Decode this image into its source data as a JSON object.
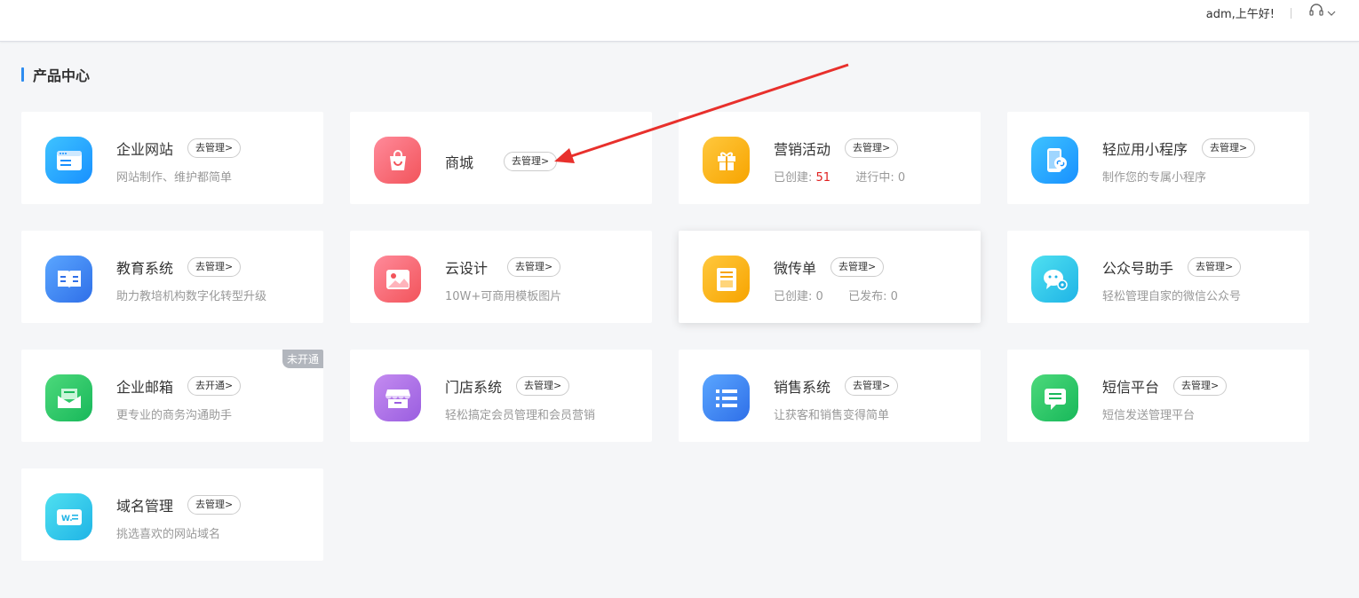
{
  "header": {
    "greeting": "adm,上午好!"
  },
  "section": {
    "title": "产品中心"
  },
  "cards": {
    "website": {
      "name": "企业网站",
      "action": "去管理>",
      "desc": "网站制作、维护都简单"
    },
    "mall": {
      "name": "商城",
      "action": "去管理>"
    },
    "marketing": {
      "name": "营销活动",
      "action": "去管理>",
      "created_label": "已创建:",
      "created_value": "51",
      "running_label": "进行中:",
      "running_value": "0"
    },
    "miniapp": {
      "name": "轻应用小程序",
      "action": "去管理>",
      "desc": "制作您的专属小程序"
    },
    "education": {
      "name": "教育系统",
      "action": "去管理>",
      "desc": "助力教培机构数字化转型升级"
    },
    "clouddesign": {
      "name": "云设计",
      "action": "去管理>",
      "desc": "10W+可商用模板图片"
    },
    "flyer": {
      "name": "微传单",
      "action": "去管理>",
      "created_label": "已创建:",
      "created_value": "0",
      "published_label": "已发布:",
      "published_value": "0"
    },
    "wechat": {
      "name": "公众号助手",
      "action": "去管理>",
      "desc": "轻松管理自家的微信公众号"
    },
    "email": {
      "name": "企业邮箱",
      "action": "去开通>",
      "desc": "更专业的商务沟通助手",
      "badge": "未开通"
    },
    "store": {
      "name": "门店系统",
      "action": "去管理>",
      "desc": "轻松搞定会员管理和会员营销"
    },
    "sales": {
      "name": "销售系统",
      "action": "去管理>",
      "desc": "让获客和销售变得简单"
    },
    "sms": {
      "name": "短信平台",
      "action": "去管理>",
      "desc": "短信发送管理平台"
    },
    "domain": {
      "name": "域名管理",
      "action": "去管理>",
      "desc": "挑选喜欢的网站域名"
    }
  },
  "icons": {
    "website": "browser-icon",
    "mall": "shopping-bag-icon",
    "marketing": "gift-icon",
    "miniapp": "mini-program-icon",
    "education": "book-icon",
    "clouddesign": "image-icon",
    "flyer": "flyer-icon",
    "wechat": "wechat-icon",
    "email": "mail-icon",
    "store": "storefront-icon",
    "sales": "list-icon",
    "sms": "message-icon",
    "domain": "domain-tag-icon",
    "support": "headset-icon",
    "dropdown": "chevron-down-icon"
  },
  "colors": {
    "accent": "#2d8cf0",
    "annotation_arrow": "#e8302c",
    "stat_highlight": "#e02020"
  }
}
